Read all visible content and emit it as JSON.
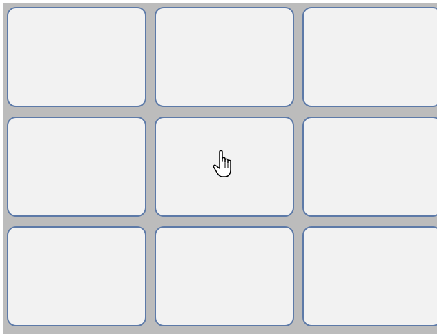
{
  "board": {
    "background_color": "#bcbcbc",
    "tile_fill_color": "#f2f2f2",
    "tile_border_color": "#5d7aa8",
    "rows": 3,
    "columns": 3,
    "tiles": [
      {
        "row": 1,
        "col": 1,
        "label": ""
      },
      {
        "row": 1,
        "col": 2,
        "label": ""
      },
      {
        "row": 1,
        "col": 3,
        "label": ""
      },
      {
        "row": 2,
        "col": 1,
        "label": ""
      },
      {
        "row": 2,
        "col": 2,
        "label": ""
      },
      {
        "row": 2,
        "col": 3,
        "label": ""
      },
      {
        "row": 3,
        "col": 1,
        "label": ""
      },
      {
        "row": 3,
        "col": 2,
        "label": ""
      },
      {
        "row": 3,
        "col": 3,
        "label": ""
      }
    ]
  },
  "cursor": {
    "icon": "hand-pointer-icon",
    "over_tile": "row 2, col 2"
  }
}
